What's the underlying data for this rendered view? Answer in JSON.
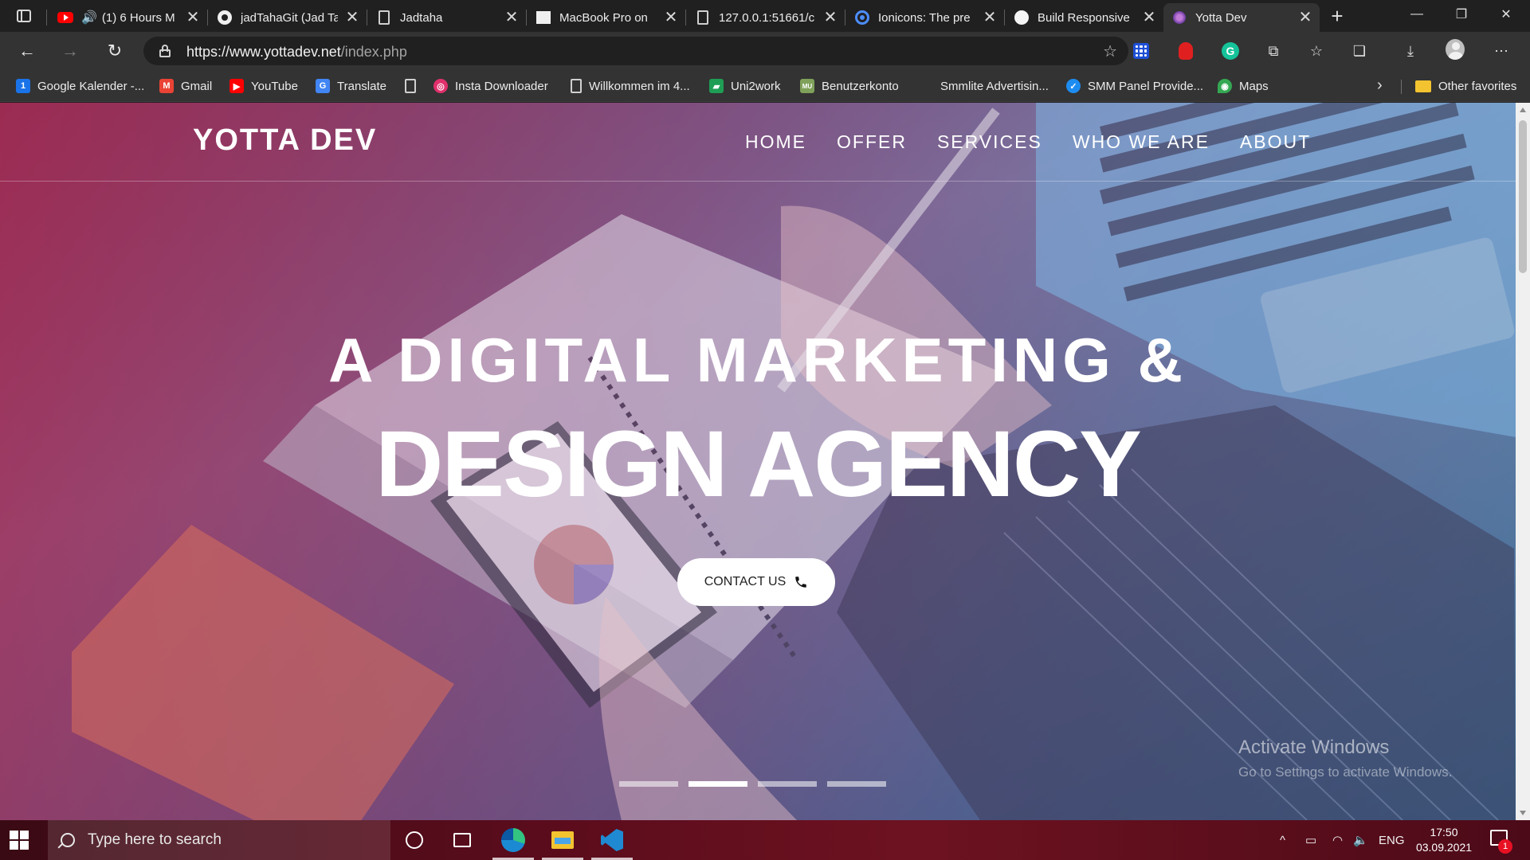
{
  "browser": {
    "tabs": [
      {
        "title": "(1) 6 Hours M",
        "icon": "youtube-icon",
        "audio": true
      },
      {
        "title": "jadTahaGit (Jad Ta",
        "icon": "github-icon"
      },
      {
        "title": "Jadtaha",
        "icon": "document-icon"
      },
      {
        "title": "MacBook Pro on",
        "icon": "apple-icon"
      },
      {
        "title": "127.0.0.1:51661/c",
        "icon": "document-icon"
      },
      {
        "title": "Ionicons: The pre",
        "icon": "ionicons-icon"
      },
      {
        "title": "Build Responsive",
        "icon": "site-icon"
      },
      {
        "title": "Yotta Dev",
        "icon": "yotta-favicon",
        "active": true
      }
    ],
    "close_glyph": "✕",
    "new_tab_glyph": "+",
    "window_controls": {
      "minimize": "—",
      "restore": "❐",
      "close": "✕"
    },
    "url": {
      "host": "https://www.yottadev.net",
      "path": "/index.php"
    },
    "nav_glyphs": {
      "back": "←",
      "forward": "→",
      "refresh": "↻"
    },
    "toolbar_glyphs": {
      "add_favorite": "☆",
      "extensions": "⧉",
      "favorites": "☆",
      "collections": "❏",
      "downloads": "⤓",
      "more": "⋯"
    },
    "ext_g_label": "G",
    "bookmarks": [
      {
        "label": "Google Kalender -...",
        "icon": "calendar-icon",
        "color": "#1a73e8",
        "glyph": "1"
      },
      {
        "label": "Gmail",
        "icon": "gmail-icon",
        "color": "#ea4335",
        "glyph": "M"
      },
      {
        "label": "YouTube",
        "icon": "youtube-icon",
        "color": "#ff0000",
        "glyph": "▶"
      },
      {
        "label": "Translate",
        "icon": "translate-icon",
        "color": "#4285f4",
        "glyph": "G"
      },
      {
        "label": "",
        "icon": "document-icon"
      },
      {
        "label": "Insta Downloader",
        "icon": "instagram-icon",
        "color": "#e1306c",
        "glyph": "◎"
      },
      {
        "label": "Willkommen im 4...",
        "icon": "document-icon"
      },
      {
        "label": "Uni2work",
        "icon": "uni2work-icon",
        "color": "#1f9d55",
        "glyph": "▰"
      },
      {
        "label": "Benutzerkonto",
        "icon": "account-icon",
        "color": "#7fa15a",
        "glyph": "MU"
      },
      {
        "label": "Smmlite Advertisin...",
        "icon": "none"
      },
      {
        "label": "SMM Panel Provide...",
        "icon": "verified-icon",
        "color": "#1d8cf0",
        "glyph": "✓"
      },
      {
        "label": "Maps",
        "icon": "maps-icon",
        "color": "#34a853",
        "glyph": "◉"
      }
    ],
    "bookmarks_overflow": "›",
    "other_favorites": "Other favorites"
  },
  "site": {
    "logo": "YOTTA DEV",
    "nav": [
      "HOME",
      "OFFER",
      "SERVICES",
      "WHO WE ARE",
      "ABOUT"
    ],
    "hero_line1": "A DIGITAL MARKETING &",
    "hero_line2": "DESIGN AGENCY",
    "cta": "CONTACT US",
    "slider": {
      "count": 4,
      "active_index": 1
    }
  },
  "watermark": {
    "line1": "Activate Windows",
    "line2": "Go to Settings to activate Windows."
  },
  "taskbar": {
    "search_placeholder": "Type here to search",
    "language": "ENG",
    "time": "17:50",
    "date": "03.09.2021",
    "notifications": "1",
    "tray_glyphs": {
      "chevron": "^",
      "battery": "▭",
      "wifi": "◠",
      "volume": "🔈"
    }
  }
}
